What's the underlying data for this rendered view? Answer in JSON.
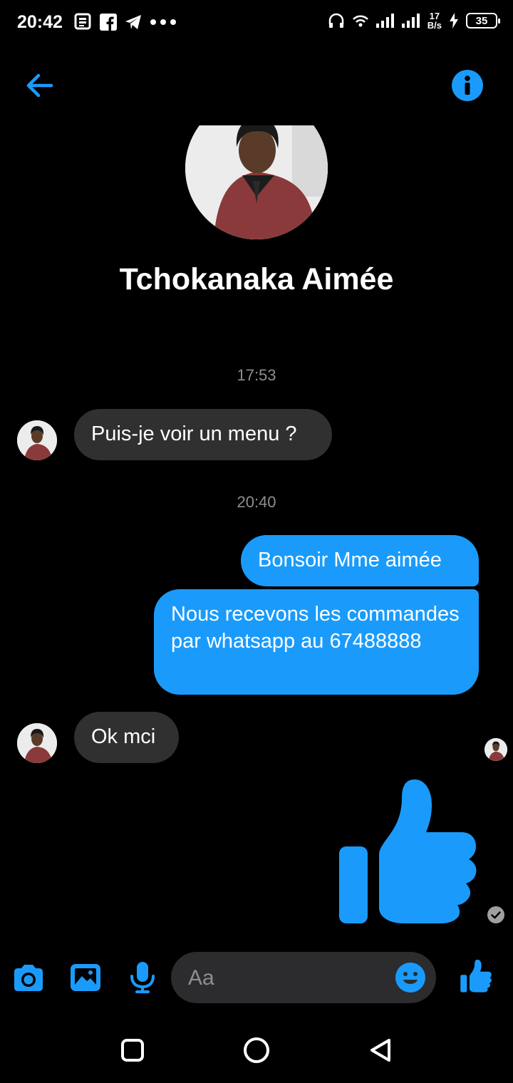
{
  "status_bar": {
    "time": "20:42",
    "net_speed_value": "17",
    "net_speed_unit": "B/s",
    "battery": "35"
  },
  "conversation": {
    "contact_name": "Tchokanaka Aimée",
    "messages": [
      {
        "type": "timestamp",
        "text": "17:53"
      },
      {
        "type": "incoming",
        "text": "Puis-je voir un menu ?"
      },
      {
        "type": "timestamp",
        "text": "20:40"
      },
      {
        "type": "outgoing",
        "text": "Bonsoir Mme aimée"
      },
      {
        "type": "outgoing",
        "text": "Nous recevons les commandes par whatsapp au 67488888"
      },
      {
        "type": "incoming",
        "text": "Ok mci"
      },
      {
        "type": "outgoing-sticker",
        "sticker": "thumbs-up-icon"
      }
    ]
  },
  "composer": {
    "placeholder": "Aa"
  },
  "theme": {
    "accent": "#1a9bfb",
    "background": "#000000",
    "incoming_bubble": "#303030"
  }
}
